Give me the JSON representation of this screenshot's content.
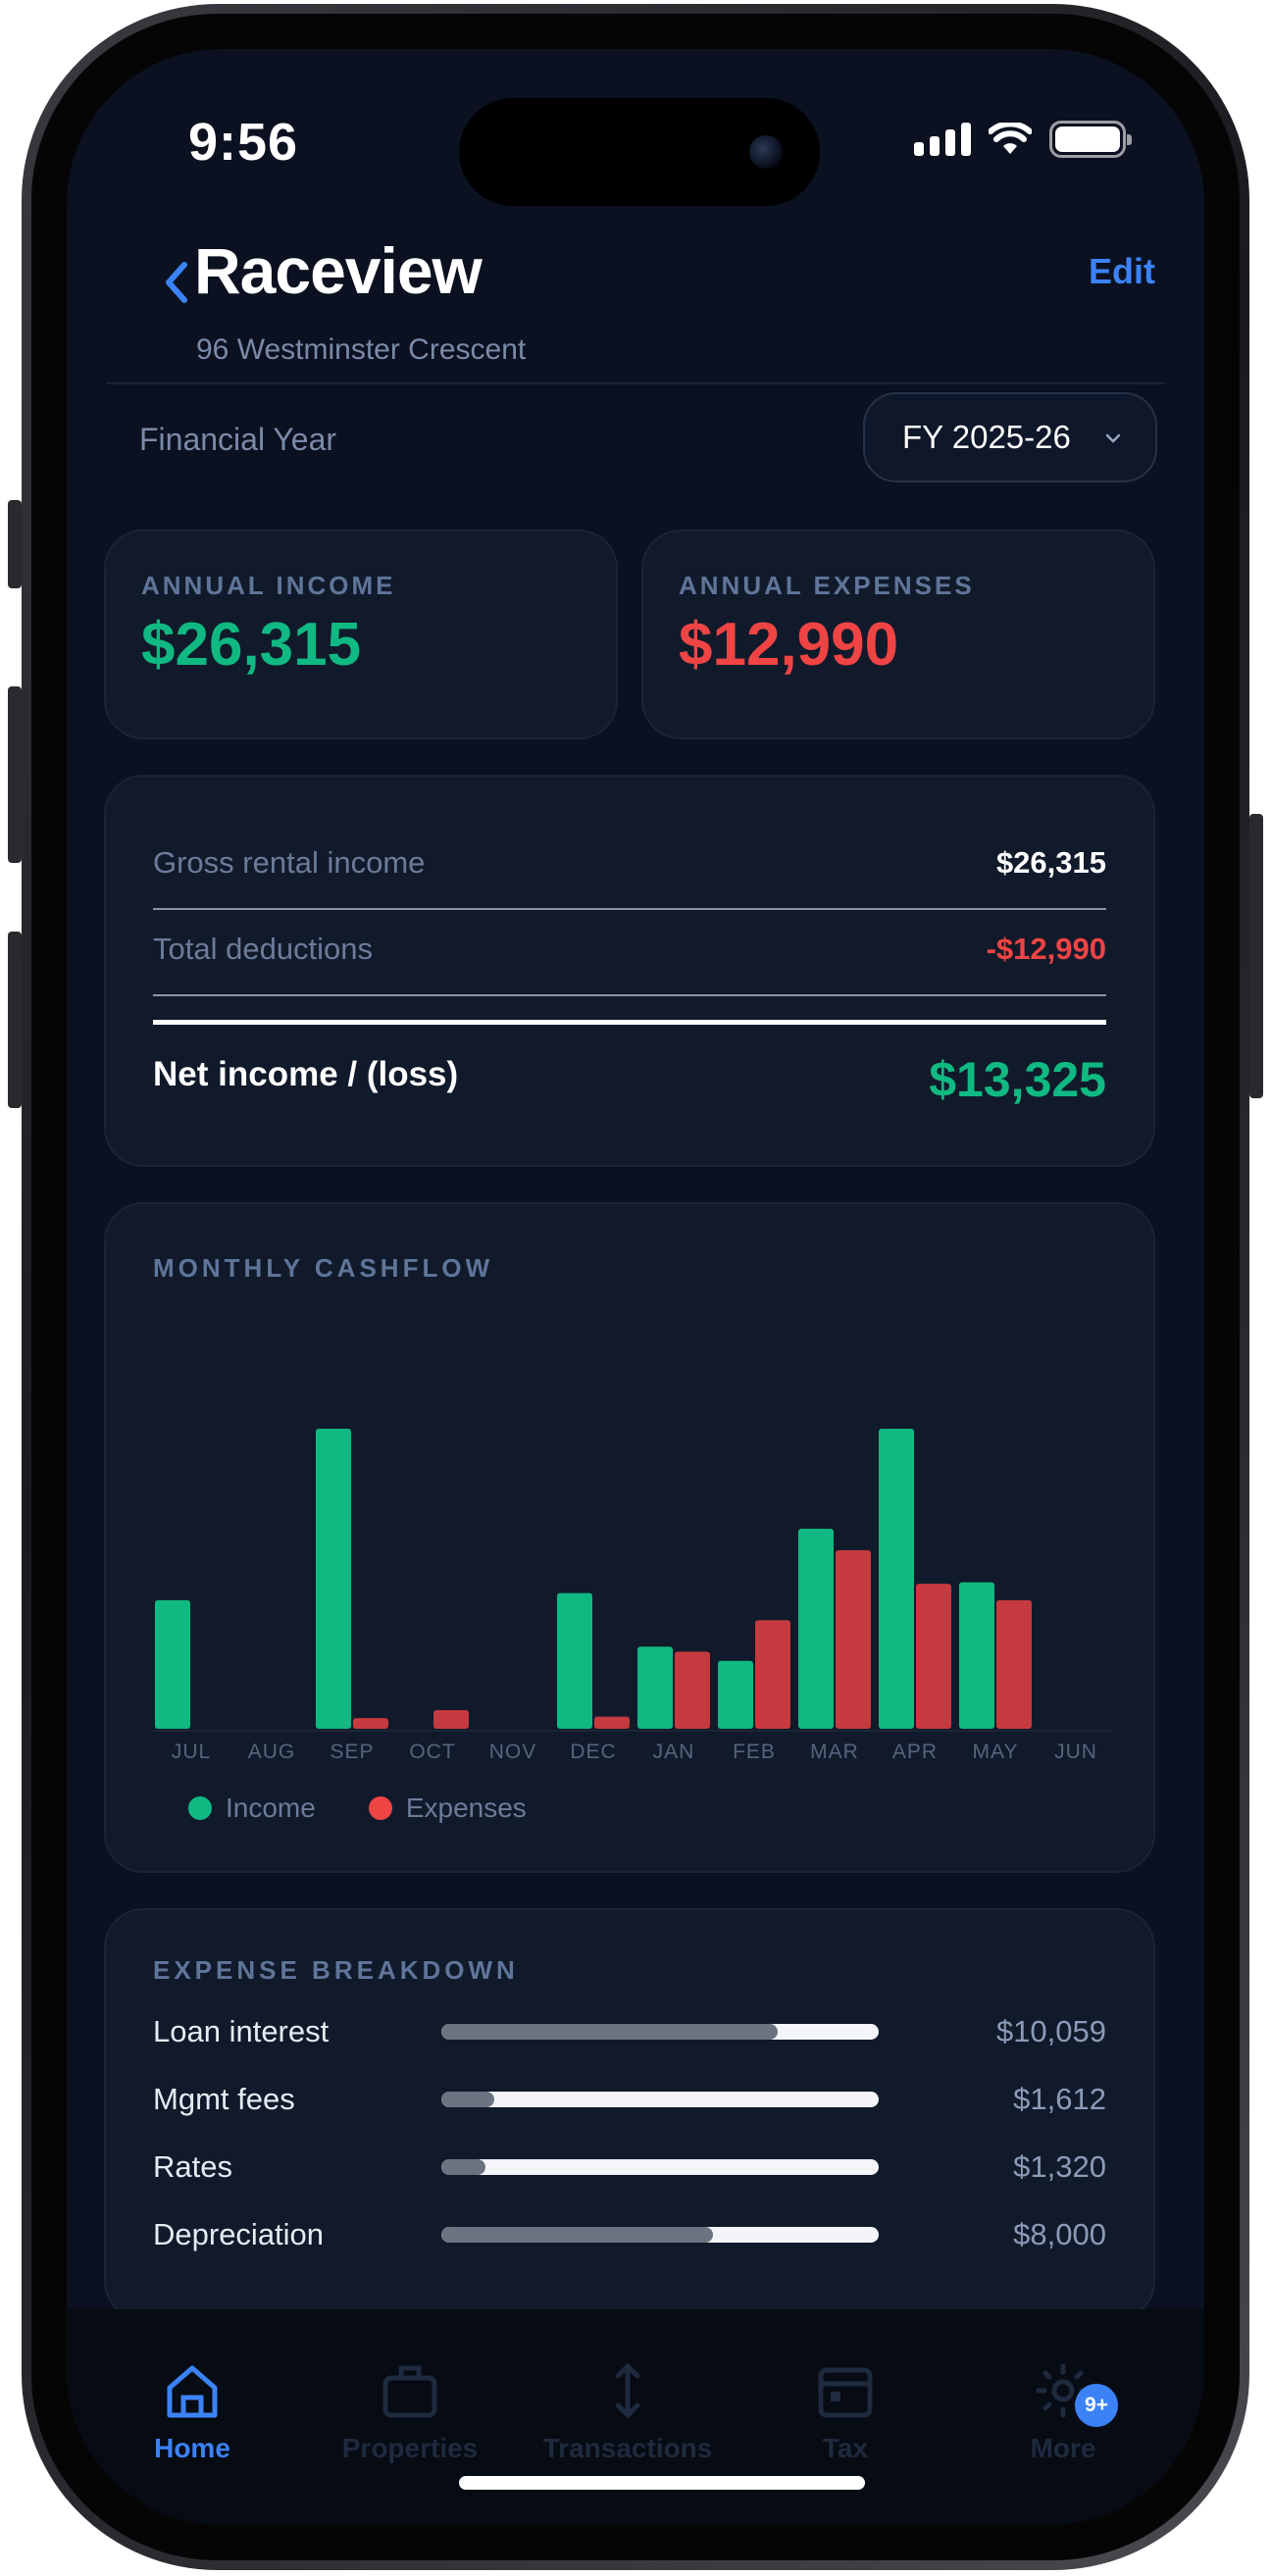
{
  "status": {
    "time": "9:56"
  },
  "header": {
    "title": "Raceview",
    "subtitle": "96 Westminster Crescent",
    "edit_label": "Edit"
  },
  "financial_year": {
    "label": "Financial Year",
    "selected": "FY 2025-26"
  },
  "kpis": {
    "income": {
      "label": "ANNUAL INCOME",
      "value": "$26,315",
      "color": "#10b981"
    },
    "expenses": {
      "label": "ANNUAL EXPENSES",
      "value": "$12,990",
      "color": "#ef4444"
    }
  },
  "summary": {
    "gross_label": "Gross rental income",
    "gross_value": "$26,315",
    "deductions_label": "Total deductions",
    "deductions_value": "-$12,990",
    "net_label": "Net income / (loss)",
    "net_value": "$13,325"
  },
  "cashflow": {
    "title": "MONTHLY CASHFLOW",
    "legend": [
      "Income",
      "Expenses"
    ]
  },
  "chart_data": {
    "type": "bar",
    "categories": [
      "JUL",
      "AUG",
      "SEP",
      "OCT",
      "NOV",
      "DEC",
      "JAN",
      "FEB",
      "MAR",
      "APR",
      "MAY",
      "JUN"
    ],
    "series": [
      {
        "name": "Income",
        "color": "#10b981",
        "values": [
          1800,
          0,
          4200,
          0,
          0,
          1900,
          1150,
          950,
          2800,
          4200,
          2050,
          0
        ]
      },
      {
        "name": "Expenses",
        "color": "#c53a3f",
        "values": [
          0,
          0,
          150,
          260,
          0,
          170,
          1080,
          1520,
          2500,
          2030,
          1800,
          0
        ]
      }
    ],
    "ylim": [
      0,
      7000
    ]
  },
  "breakdown": {
    "title": "EXPENSE BREAKDOWN",
    "items": [
      {
        "name": "Loan interest",
        "value": "$10,059",
        "fraction": 0.77
      },
      {
        "name": "Mgmt fees",
        "value": "$1,612",
        "fraction": 0.12
      },
      {
        "name": "Rates",
        "value": "$1,320",
        "fraction": 0.1
      },
      {
        "name": "Depreciation",
        "value": "$8,000",
        "fraction": 0.62
      }
    ]
  },
  "tabs": [
    {
      "label": "Home",
      "icon": "home-icon",
      "active": true
    },
    {
      "label": "Properties",
      "icon": "briefcase-icon",
      "active": false
    },
    {
      "label": "Transactions",
      "icon": "arrows-updown-icon",
      "active": false
    },
    {
      "label": "Tax",
      "icon": "calendar-icon",
      "active": false
    },
    {
      "label": "More",
      "icon": "gear-icon",
      "active": false,
      "badge": "9+"
    }
  ],
  "colors": {
    "accent": "#3b82f6",
    "background": "#0b1120",
    "card": "#111a2b"
  }
}
